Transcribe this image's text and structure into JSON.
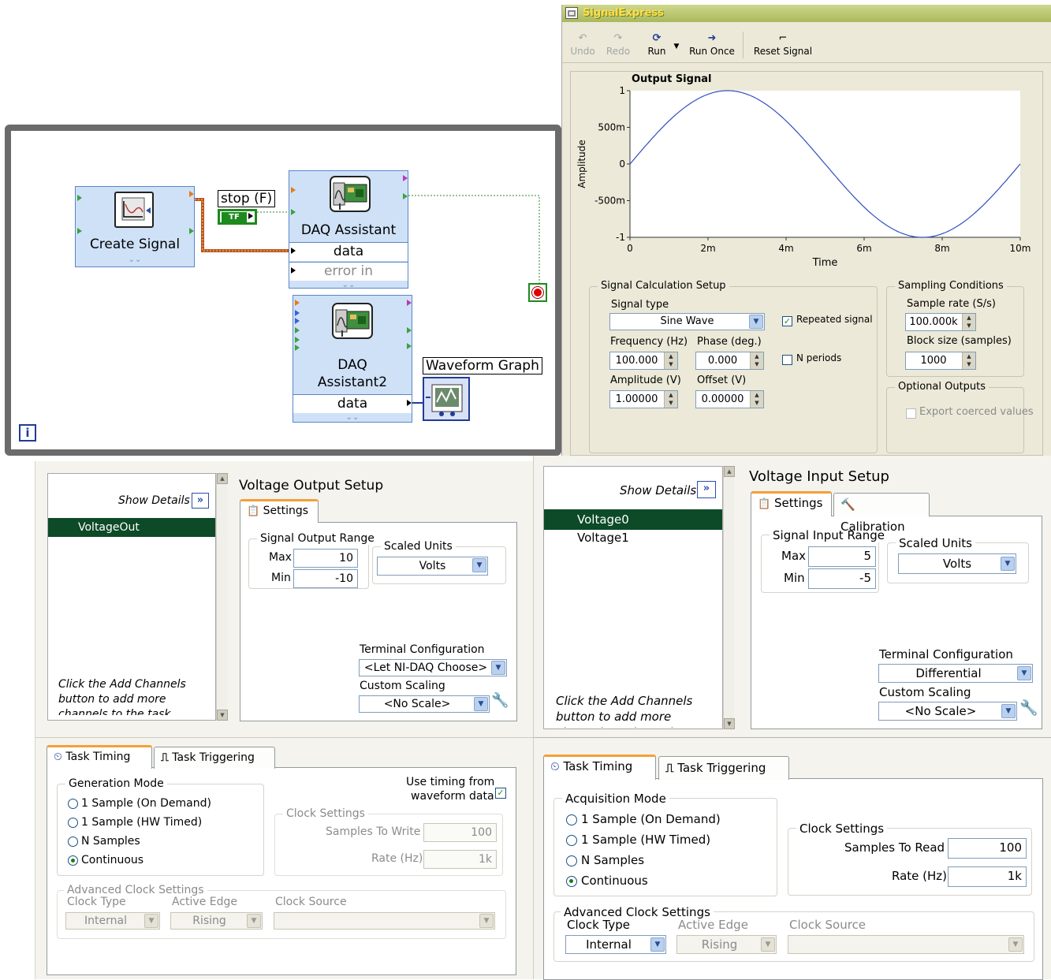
{
  "block_diagram": {
    "create_signal": "Create Signal",
    "stop_label": "stop (F)",
    "stop_bool": "TF",
    "daq1_title": "DAQ Assistant",
    "daq1_data": "data",
    "daq1_error": "error in",
    "daq2_title_1": "DAQ",
    "daq2_title_2": "Assistant2",
    "daq2_data": "data",
    "waveform_graph": "Waveform Graph",
    "loop_iter": "i"
  },
  "signalexpress": {
    "title": "SignalExpress",
    "toolbar": {
      "undo": "Undo",
      "redo": "Redo",
      "run": "Run",
      "run_once": "Run Once",
      "reset_signal": "Reset Signal"
    },
    "graph_title": "Output Signal",
    "ylabel": "Amplitude",
    "xlabel": "Time",
    "calc_setup": {
      "title": "Signal Calculation Setup",
      "signal_type_label": "Signal type",
      "signal_type": "Sine Wave",
      "repeated_signal": "Repeated signal",
      "n_periods": "N periods",
      "frequency_label": "Frequency (Hz)",
      "frequency": "100.000",
      "phase_label": "Phase (deg.)",
      "phase": "0.000",
      "amplitude_label": "Amplitude (V)",
      "amplitude": "1.00000",
      "offset_label": "Offset (V)",
      "offset": "0.00000"
    },
    "sampling": {
      "title": "Sampling Conditions",
      "rate_label": "Sample rate (S/s)",
      "rate": "100.000k",
      "block_label": "Block size (samples)",
      "block": "1000"
    },
    "optional": {
      "title": "Optional Outputs",
      "export": "Export coerced values"
    }
  },
  "chart_data": {
    "type": "line",
    "title": "Output Signal",
    "xlabel": "Time",
    "ylabel": "Amplitude",
    "x_ticks": [
      "0",
      "2m",
      "4m",
      "6m",
      "8m",
      "10m"
    ],
    "y_ticks": [
      "1",
      "500m",
      "0",
      "-500m",
      "-1"
    ],
    "xlim": [
      0,
      0.01
    ],
    "ylim": [
      -1,
      1
    ],
    "series": [
      {
        "function": "sine",
        "frequency_hz": 100,
        "amplitude": 1,
        "phase_deg": 0,
        "offset": 0
      }
    ],
    "grid": false
  },
  "output_panel": {
    "show_details": "Show Details",
    "channel": "VoltageOut",
    "hint": "Click the Add Channels button to add more channels to the task",
    "setup_title": "Voltage Output Setup",
    "tab_settings": "Settings",
    "range_title": "Signal Output Range",
    "max_label": "Max",
    "max": "10",
    "min_label": "Min",
    "min": "-10",
    "scaled_units_title": "Scaled Units",
    "scaled_units": "Volts",
    "terminal_label": "Terminal Configuration",
    "terminal": "<Let NI-DAQ Choose>",
    "custom_scaling_label": "Custom Scaling",
    "custom_scaling": "<No Scale>"
  },
  "input_panel": {
    "show_details": "Show Details",
    "channels": [
      "Voltage0",
      "Voltage1"
    ],
    "hint": "Click the Add Channels button to add more channels to the task",
    "setup_title": "Voltage Input Setup",
    "tab_settings": "Settings",
    "tab_calibration": "Calibration",
    "range_title": "Signal Input Range",
    "max_label": "Max",
    "max": "5",
    "min_label": "Min",
    "min": "-5",
    "scaled_units_title": "Scaled Units",
    "scaled_units": "Volts",
    "terminal_label": "Terminal Configuration",
    "terminal": "Differential",
    "custom_scaling_label": "Custom Scaling",
    "custom_scaling": "<No Scale>"
  },
  "output_timing": {
    "tab_timing": "Task Timing",
    "tab_triggering": "Task Triggering",
    "mode_title": "Generation Mode",
    "modes": [
      "1 Sample (On Demand)",
      "1 Sample (HW Timed)",
      "N Samples",
      "Continuous"
    ],
    "use_timing_1": "Use timing from",
    "use_timing_2": "waveform data",
    "clock_title": "Clock Settings",
    "samples_label": "Samples To Write",
    "samples": "100",
    "rate_label": "Rate (Hz)",
    "rate": "1k",
    "adv_title": "Advanced Clock Settings",
    "clock_type_label": "Clock Type",
    "clock_type": "Internal",
    "active_edge_label": "Active Edge",
    "active_edge": "Rising",
    "clock_source_label": "Clock Source"
  },
  "input_timing": {
    "tab_timing": "Task Timing",
    "tab_triggering": "Task Triggering",
    "mode_title": "Acquisition Mode",
    "modes": [
      "1 Sample (On Demand)",
      "1 Sample (HW Timed)",
      "N Samples",
      "Continuous"
    ],
    "clock_title": "Clock Settings",
    "samples_label": "Samples To Read",
    "samples": "100",
    "rate_label": "Rate (Hz)",
    "rate": "1k",
    "adv_title": "Advanced Clock Settings",
    "clock_type_label": "Clock Type",
    "clock_type": "Internal",
    "active_edge_label": "Active Edge",
    "active_edge": "Rising",
    "clock_source_label": "Clock Source"
  }
}
